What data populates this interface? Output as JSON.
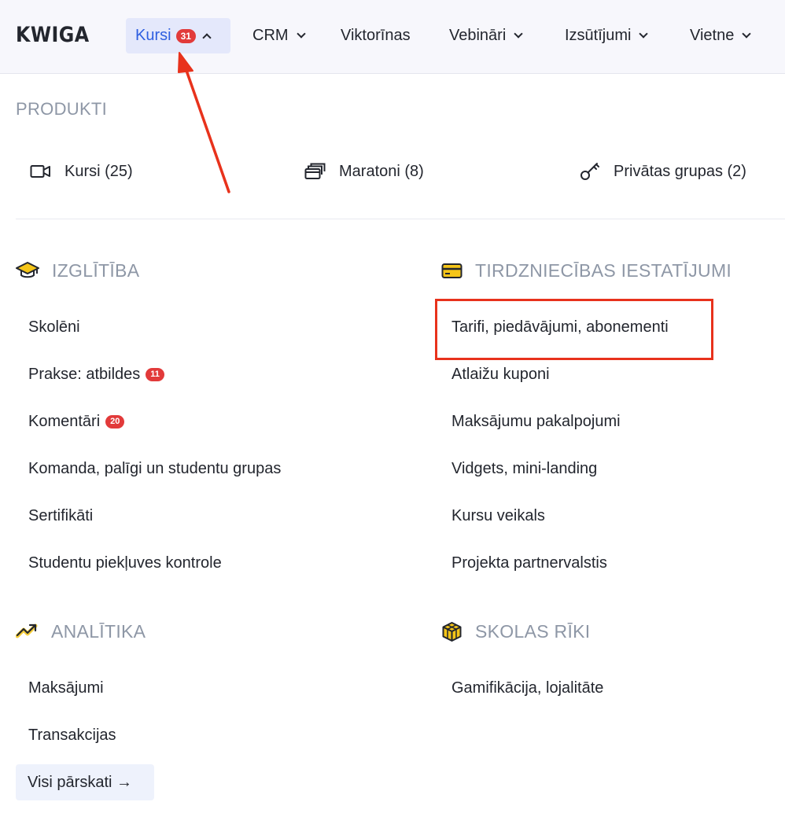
{
  "header": {
    "logo": "KWIGA",
    "nav": [
      {
        "label": "Kursi",
        "badge": "31"
      },
      {
        "label": "CRM"
      },
      {
        "label": "Viktorīnas"
      },
      {
        "label": "Vebināri"
      },
      {
        "label": "Izsūtījumi"
      },
      {
        "label": "Vietne"
      }
    ]
  },
  "products": {
    "heading": "PRODUKTI",
    "items": [
      {
        "label": "Kursi (25)",
        "icon": "video-camera-icon"
      },
      {
        "label": "Maratoni (8)",
        "icon": "stacked-cards-icon"
      },
      {
        "label": "Privātas grupas (2)",
        "icon": "key-icon"
      }
    ]
  },
  "education": {
    "title": "IZGLĪTĪBA",
    "icon": "graduation-cap-icon",
    "items": [
      {
        "label": "Skolēni"
      },
      {
        "label": "Prakse: atbildes",
        "badge": "11"
      },
      {
        "label": "Komentāri",
        "badge": "20"
      },
      {
        "label": "Komanda, palīgi un studentu grupas"
      },
      {
        "label": "Sertifikāti"
      },
      {
        "label": "Studentu piekļuves kontrole"
      }
    ]
  },
  "sales": {
    "title": "TIRDZNIECĪBAS IESTATĪJUMI",
    "icon": "credit-card-icon",
    "items": [
      {
        "label": "Tarifi, piedāvājumi, abonementi"
      },
      {
        "label": "Atlaižu kuponi"
      },
      {
        "label": "Maksājumu pakalpojumi"
      },
      {
        "label": "Vidgets, mini-landing"
      },
      {
        "label": "Kursu veikals"
      },
      {
        "label": "Projekta partnervalstis"
      }
    ]
  },
  "analytics": {
    "title": "ANALĪTIKA",
    "icon": "trend-up-icon",
    "items": [
      {
        "label": "Maksājumi"
      },
      {
        "label": "Transakcijas"
      }
    ],
    "all_reports": "Visi pārskati →"
  },
  "tools": {
    "title": "SKOLAS RĪKI",
    "icon": "cube-icon",
    "items": [
      {
        "label": "Gamifikācija, lojalitāte"
      }
    ]
  },
  "colors": {
    "accent": "#2f5fe0",
    "badge": "#e23a3a",
    "annotation": "#e8321c",
    "icon_yellow": "#f5c518"
  }
}
